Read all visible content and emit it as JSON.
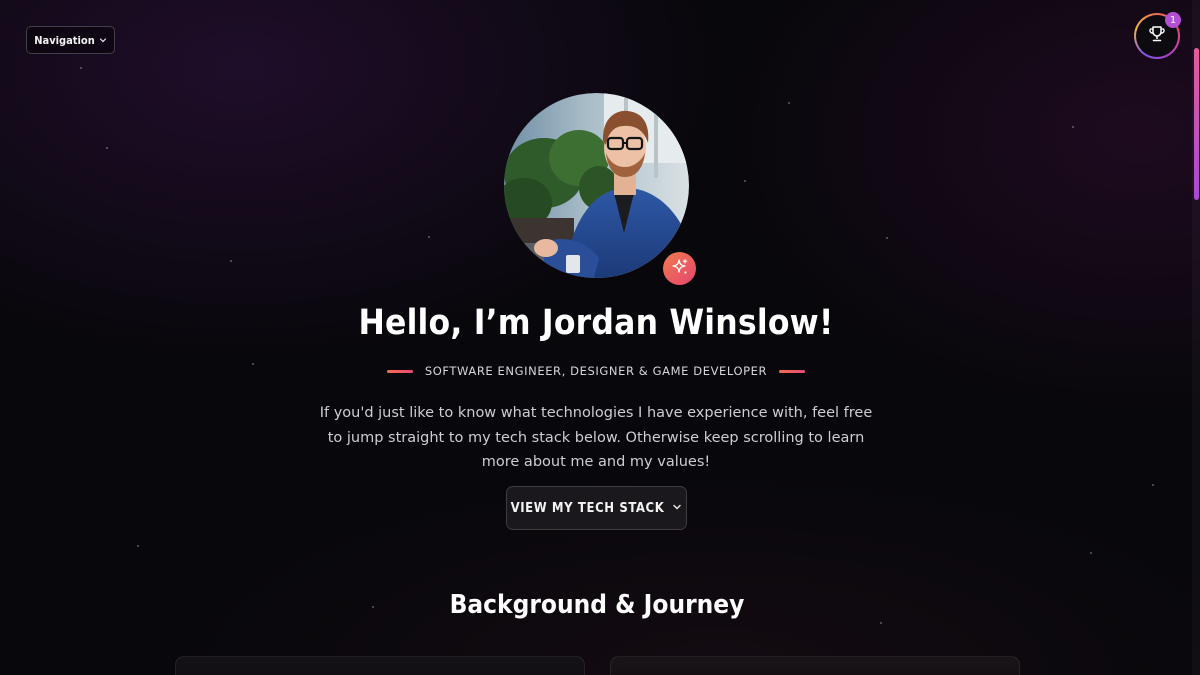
{
  "nav": {
    "label": "Navigation",
    "chevron_icon": "chevron-down-icon"
  },
  "trophy": {
    "icon": "trophy-icon",
    "badge_count": "1"
  },
  "hero": {
    "avatar_alt": "Jordan Winslow portrait",
    "sparkle_icon": "sparkle-icon",
    "title": "Hello, I’m Jordan Winslow!",
    "subtitle": "SOFTWARE ENGINEER, DESIGNER & GAME DEVELOPER",
    "intro": "If you'd just like to know what technologies I have experience with, feel free to jump straight to my tech stack below. Otherwise keep scrolling to learn more about me and my values!",
    "cta_label": "VIEW MY TECH STACK"
  },
  "sections": {
    "background_title": "Background & Journey"
  },
  "colors": {
    "background": "#08070b",
    "accent_orange": "#f26b4e",
    "accent_pink": "#e9497a",
    "accent_purple": "#b24fd6"
  }
}
